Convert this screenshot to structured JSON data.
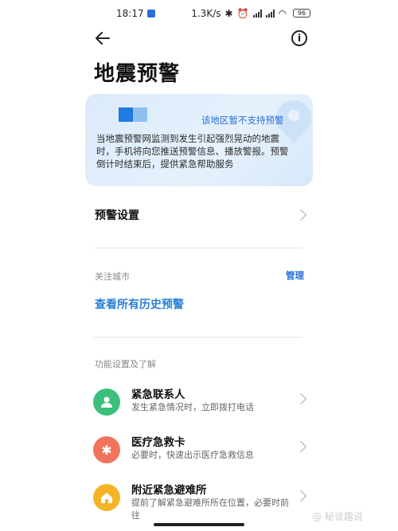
{
  "status_bar": {
    "time": "18:17",
    "network_speed": "1.3K/s",
    "battery": "96"
  },
  "header": {
    "back_icon": "arrow-left-icon",
    "info_icon": "info-circle-icon",
    "title": "地震预警"
  },
  "banner": {
    "status": "该地区暂不支持预警",
    "description": "当地震预警网监测到发生引起强烈晃动的地震时，手机将向您推送预警信息、播放警报。预警倒计时结束后，提供紧急帮助服务",
    "accent_color": "#2a6fd6"
  },
  "settings": {
    "warning_settings_label": "预警设置"
  },
  "cities": {
    "section_label": "关注城市",
    "manage_label": "管理",
    "history_link": "查看所有历史预警"
  },
  "features": {
    "section_label": "功能设置及了解",
    "items": [
      {
        "title": "紧急联系人",
        "desc": "发生紧急情况时，立即拨打电话",
        "icon": "contact-icon",
        "color": "#3ac07a"
      },
      {
        "title": "医疗急救卡",
        "desc": "必要时，快速出示医疗急救信息",
        "icon": "medical-icon",
        "color": "#f0735c"
      },
      {
        "title": "附近紧急避难所",
        "desc": "提前了解紧急避难所所在位置，必要时前往",
        "icon": "shelter-icon",
        "color": "#f5b428"
      }
    ]
  },
  "watermark": "@ 秘谈趣说"
}
